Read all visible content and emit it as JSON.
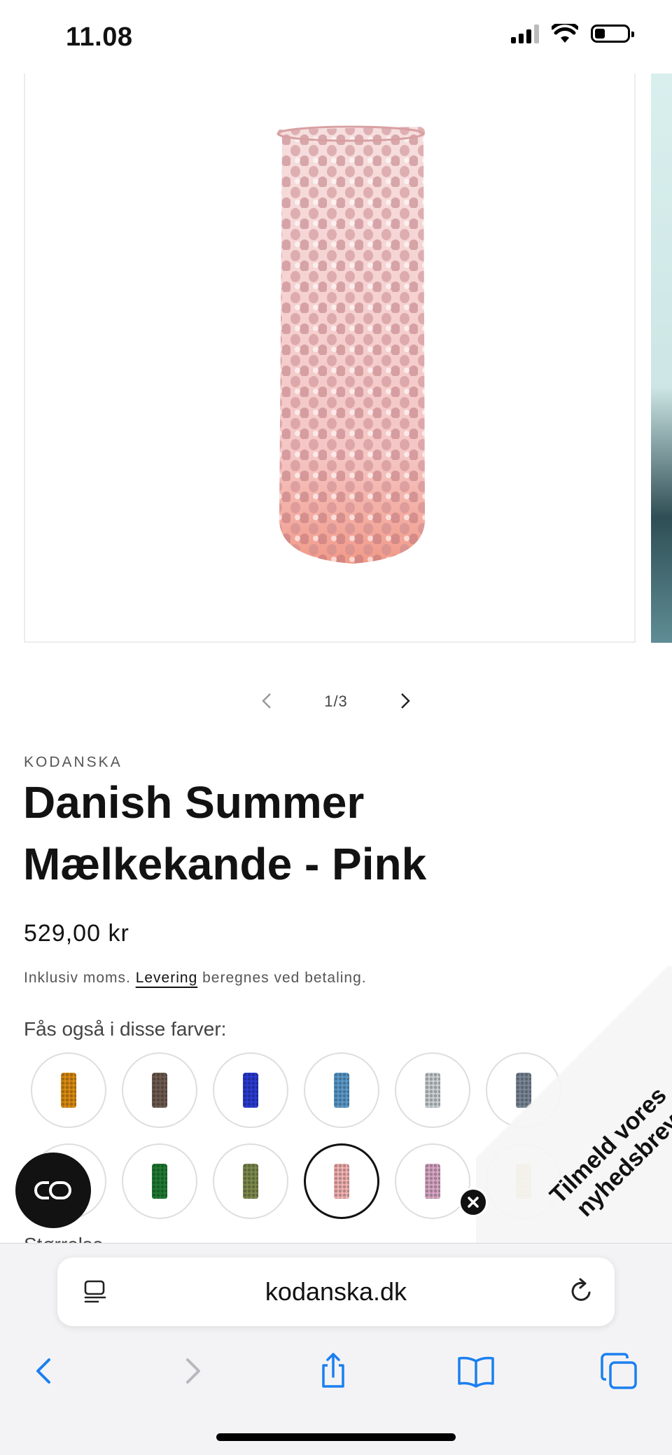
{
  "status_bar": {
    "time": "11.08"
  },
  "gallery": {
    "counter": "1/3",
    "product_color": "#f3b4b0"
  },
  "product": {
    "vendor": "KODANSKA",
    "title": "Danish Summer Mælkekande - Pink",
    "price": "529,00 kr",
    "tax_prefix": "Inklusiv moms. ",
    "tax_link": "Levering",
    "tax_suffix": " beregnes ved betaling.",
    "colors_label": "Fås også i disse farver:",
    "size_label": "Størrelse"
  },
  "color_swatches": [
    {
      "name": "amber",
      "color": "#d98a12",
      "selected": false
    },
    {
      "name": "smoke",
      "color": "#6e5b50",
      "selected": false
    },
    {
      "name": "cobalt",
      "color": "#2a3bd2",
      "selected": false
    },
    {
      "name": "light-blue",
      "color": "#5a9ac9",
      "selected": false
    },
    {
      "name": "clear",
      "color": "#c9cfd2",
      "selected": false
    },
    {
      "name": "grey",
      "color": "#7a8796",
      "selected": false
    },
    {
      "name": "hidden-by-chat",
      "color": "#ffffff",
      "selected": false
    },
    {
      "name": "green",
      "color": "#1f7a32",
      "selected": false
    },
    {
      "name": "olive",
      "color": "#7c8a4c",
      "selected": false
    },
    {
      "name": "pink",
      "color": "#f2b3b3",
      "selected": true
    },
    {
      "name": "lilac",
      "color": "#d7a7c4",
      "selected": false
    },
    {
      "name": "yellow",
      "color": "#e8c41c",
      "selected": false
    }
  ],
  "newsletter": {
    "text": "Tilmeld vores nyhedsbrev"
  },
  "browser": {
    "url": "kodanska.dk",
    "accent": "#1b7ff0"
  }
}
